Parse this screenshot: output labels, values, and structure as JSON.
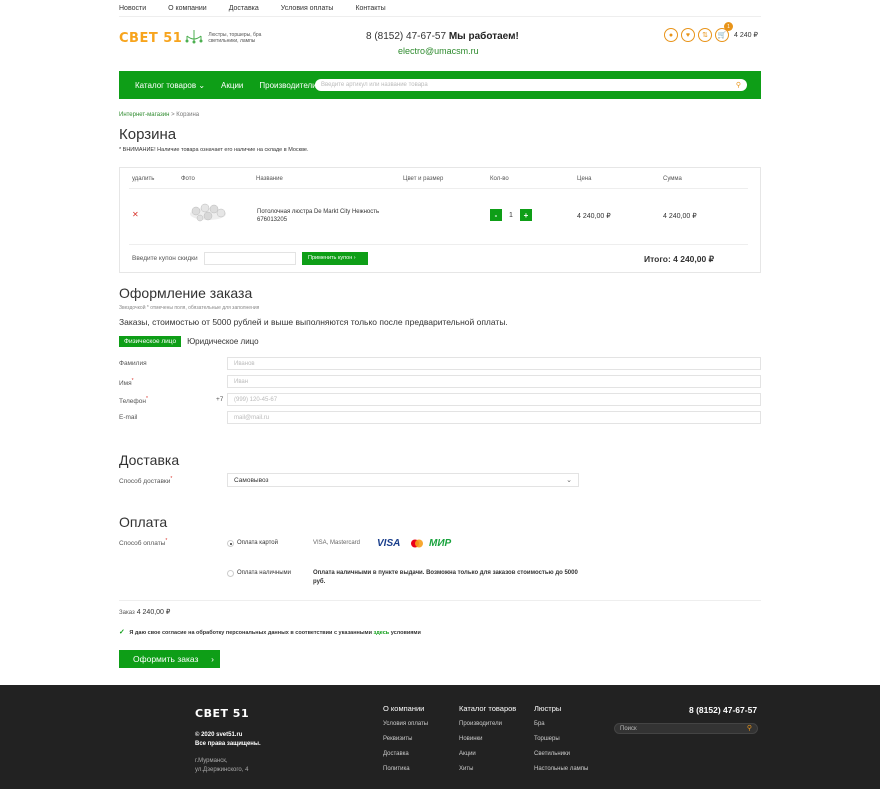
{
  "topnav": [
    "Новости",
    "О компании",
    "Доставка",
    "Условия оплаты",
    "Контакты"
  ],
  "logo": {
    "text": "СВЕТ 51",
    "tagline": "Люстры, торшеры, бра светильники, лампы"
  },
  "header": {
    "phone": "8 (8152) 47-67-57",
    "working": "Мы работаем!",
    "email": "electro@umacsm.ru",
    "cart_count": "1",
    "cart_sum": "4 240 ₽"
  },
  "menu": {
    "catalog": "Каталог товаров",
    "promo": "Акции",
    "makers": "Производители",
    "search_placeholder": "Введите артикул или название товара"
  },
  "breadcrumb": {
    "home": "Интернет-магазин",
    "sep": ">",
    "current": "Корзина"
  },
  "cart": {
    "title": "Корзина",
    "notice": "* ВНИМАНИЕ! Наличие товара означает его наличие на складе в Москве.",
    "columns": [
      "удалить",
      "Фото",
      "Название",
      "Цвет и размер",
      "Кол-во",
      "Цена",
      "Сумма"
    ],
    "item": {
      "name": "Потолочная люстра De Markt City Нежность",
      "sku": "676013205",
      "qty": "1",
      "price": "4 240,00 ₽",
      "sum": "4 240,00 ₽"
    },
    "coupon_label": "Введите купон скидки",
    "coupon_button": "Применить купон",
    "total": "Итого: 4 240,00 ₽"
  },
  "order": {
    "title": "Оформление заказа",
    "required_note": "Звездочкой * отмечены поля, обязательные для заполнения",
    "prepay_note": "Заказы, стоимостью от 5000 рублей и выше выполняются только после предварительной оплаты.",
    "type_individual": "Физическое лицо",
    "type_legal": "Юридическое лицо",
    "fields": {
      "surname": {
        "label": "Фамилия",
        "placeholder": "Иванов"
      },
      "name": {
        "label": "Имя",
        "placeholder": "Иван"
      },
      "phone": {
        "label": "Телефон",
        "prefix": "+7",
        "placeholder": "(999) 120-45-67"
      },
      "email": {
        "label": "E-mail",
        "placeholder": "mail@mail.ru"
      }
    }
  },
  "delivery": {
    "title": "Доставка",
    "label": "Способ доставки",
    "value": "Самовывоз"
  },
  "payment": {
    "title": "Оплата",
    "label": "Способ оплаты",
    "card": "Оплата картой",
    "card_types": "VISA, Mastercard",
    "visa": "VISA",
    "mir": "МИР",
    "cash": "Оплата наличными",
    "cash_note": "Оплата наличными в пункте выдачи. Возможна только для заказов стоимостью до 5000 руб."
  },
  "summary": {
    "label": "Заказ",
    "value": "4 240,00 ₽",
    "agree_text": "Я даю свое согласие на обработку персональных данных в соответствии с указанными",
    "agree_link": "здесь",
    "agree_tail": "условиями",
    "submit": "Оформить заказ"
  },
  "footer": {
    "logo": "СВЕТ 51",
    "copy1": "© 2020 svet51.ru",
    "copy2": "Все права защищены.",
    "addr1": "г.Мурманск,",
    "addr2": "ул.Дзержинского, 4",
    "col1": {
      "title": "О компании",
      "items": [
        "Условия оплаты",
        "Реквизиты",
        "Доставка",
        "Политика"
      ]
    },
    "col2": {
      "title": "Каталог товаров",
      "items": [
        "Производители",
        "Новинки",
        "Акции",
        "Хиты"
      ]
    },
    "col3": {
      "title": "Люстры",
      "items": [
        "Бра",
        "Торшеры",
        "Светильники",
        "Настольные лампы"
      ]
    },
    "phone": "8 (8152) 47-67-57",
    "search_placeholder": "Поиск"
  },
  "colors": {
    "green": "#0e9e17",
    "orange": "#e8941a",
    "footer_bg": "#222222"
  }
}
